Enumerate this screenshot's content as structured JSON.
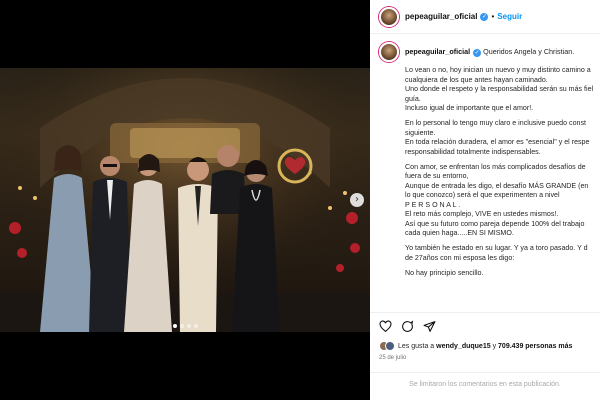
{
  "post": {
    "username": "pepeaguilar_oficial",
    "separator": "•",
    "follow_label": "Seguir"
  },
  "caption": {
    "username": "pepeaguilar_oficial",
    "first_line": "Queridos Angela y Christian.",
    "paragraphs": [
      [
        "Lo vean o no, hoy inician un nuevo y muy distinto camino a",
        "cualquiera de los que antes hayan caminado.",
        "Uno donde el respeto y la responsabilidad serán su más fiel",
        "guía.",
        "Incluso igual de importante que el amor!."
      ],
      [
        "En lo personal lo tengo muy claro e inclusive puedo const",
        "siguiente.",
        "En toda relación duradera, el amor es \"esencial\" y el respe",
        "responsabilidad totalmente indispensables."
      ],
      [
        "Con amor, se enfrentan los más complicados desafíos de",
        "fuera de su entorno,",
        "Aunque de entrada les digo, el desafío MÁS GRANDE (en",
        "lo que conozco) será el que experimenten a nivel",
        "P E R S O N A L .",
        "El reto más complejo, VIVE en ustedes mismos!.",
        "Así que su futuro como pareja depende 100% del trabajo",
        "cada quien haga.....EN SI MISMO."
      ],
      [
        "Yo también he estado en su lugar. Y ya a toro pasado. Y d",
        "de 27años con mi esposa les digo:"
      ],
      [
        "No hay principio sencillo."
      ]
    ]
  },
  "likes": {
    "prefix": "Les gusta a",
    "user": "wendy_duque15",
    "middle": "y",
    "count": "709.439 personas más"
  },
  "date": "25 de julio",
  "comments_closed": "Se limitaron los comentarios en esta publicación.",
  "icons": [
    "heart-icon",
    "comment-icon",
    "share-icon"
  ],
  "carousel": {
    "total": 4,
    "active": 1
  },
  "colors": {
    "accent": "#0095f6",
    "verified": "#3897f0"
  }
}
